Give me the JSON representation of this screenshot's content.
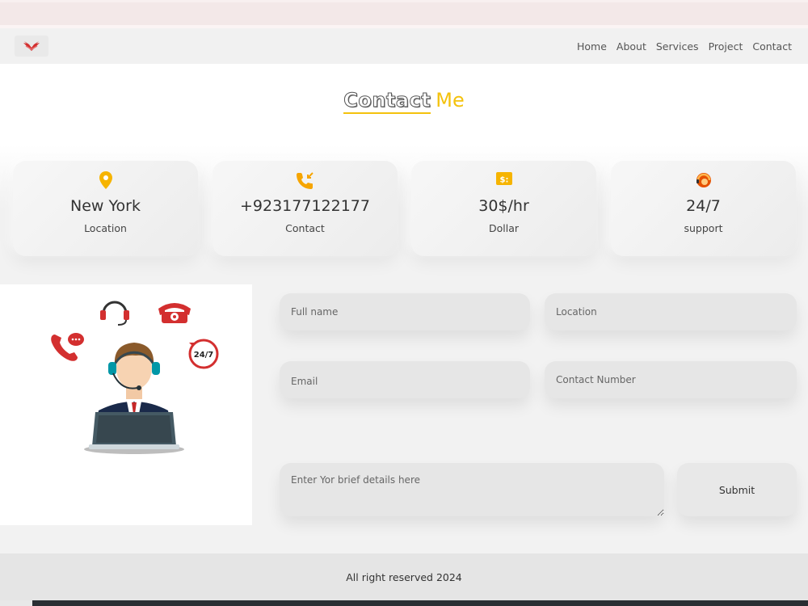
{
  "nav": {
    "logo_icon": "wings-logo-icon",
    "links": [
      "Home",
      "About",
      "Services",
      "Project",
      "Contact"
    ]
  },
  "heading": {
    "part1": "Contact",
    "part2": "Me"
  },
  "cards": [
    {
      "icon": "location-pin-icon",
      "value": "New York",
      "label": "Location"
    },
    {
      "icon": "phone-call-icon",
      "value": "+923177122177",
      "label": "Contact"
    },
    {
      "icon": "dollar-bill-icon",
      "value": "30$/hr",
      "label": "Dollar"
    },
    {
      "icon": "support-agent-icon",
      "value": "24/7",
      "label": "support"
    }
  ],
  "illustration": {
    "badge": "24/7"
  },
  "form": {
    "fullname_placeholder": "Full name",
    "location_placeholder": "Location",
    "email_placeholder": "Email",
    "contact_placeholder": "Contact Number",
    "details_placeholder": "Enter Yor brief details here",
    "submit_label": "Submit"
  },
  "footer": {
    "text": "All right reserved 2024"
  },
  "colors": {
    "accent": "#f4c20d",
    "icon_orange": "#f6a500",
    "illustration_red": "#d32f2f"
  }
}
